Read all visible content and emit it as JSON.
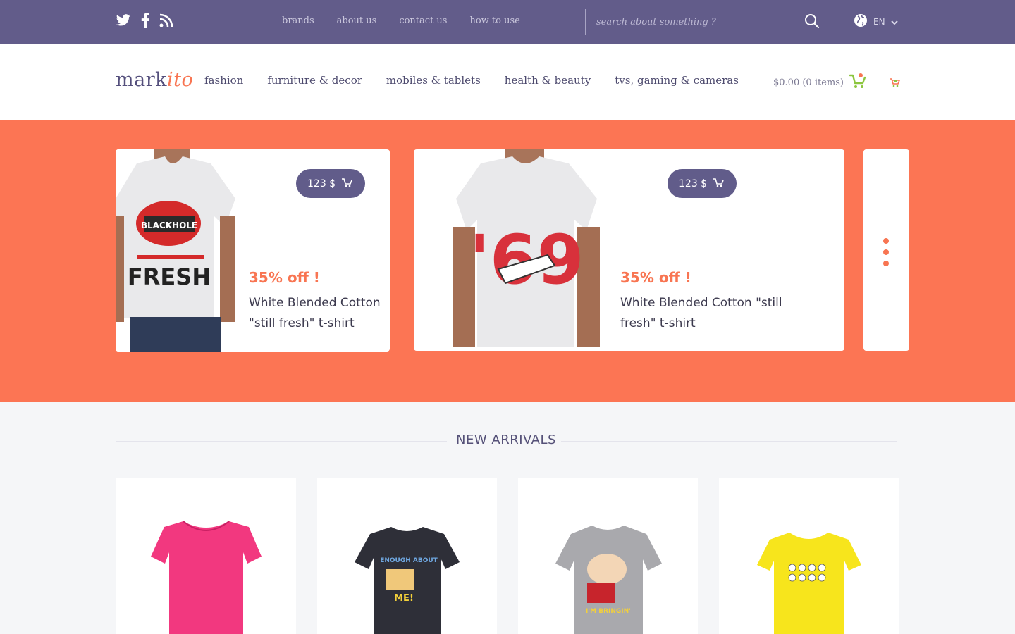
{
  "topbar": {
    "social": [
      {
        "icon": "twitter-icon"
      },
      {
        "icon": "facebook-icon"
      },
      {
        "icon": "rss-icon"
      }
    ],
    "nav": [
      "brands",
      "about us",
      "contact us",
      "how to use"
    ],
    "search_placeholder": "search about something ?",
    "language": "EN"
  },
  "header": {
    "logo_main": "mark",
    "logo_accent": "ito",
    "nav": [
      "fashion",
      "furniture & decor",
      "mobiles & tablets",
      "health & beauty",
      "tvs, gaming & cameras"
    ],
    "cart_summary": "$0.00 (0 items)"
  },
  "hero": {
    "cards": [
      {
        "price": "123 $",
        "discount": "35% off !",
        "name": "White Blended Cotton \"still fresh\" t-shirt"
      },
      {
        "price": "123 $",
        "discount": "35% off !",
        "name": "White Blended Cotton \"still fresh\" t-shirt"
      }
    ]
  },
  "arrivals": {
    "title": "NEW ARRIVALS",
    "products": [
      {
        "color": "#f2387f"
      },
      {
        "color": "#2e2f38"
      },
      {
        "color": "#a9a9ad"
      },
      {
        "color": "#f7e51c"
      }
    ]
  },
  "colors": {
    "topbar": "#625c8a",
    "accent": "#f87552",
    "hero_bg": "#fc7554",
    "cart_green": "#8cc63f"
  }
}
